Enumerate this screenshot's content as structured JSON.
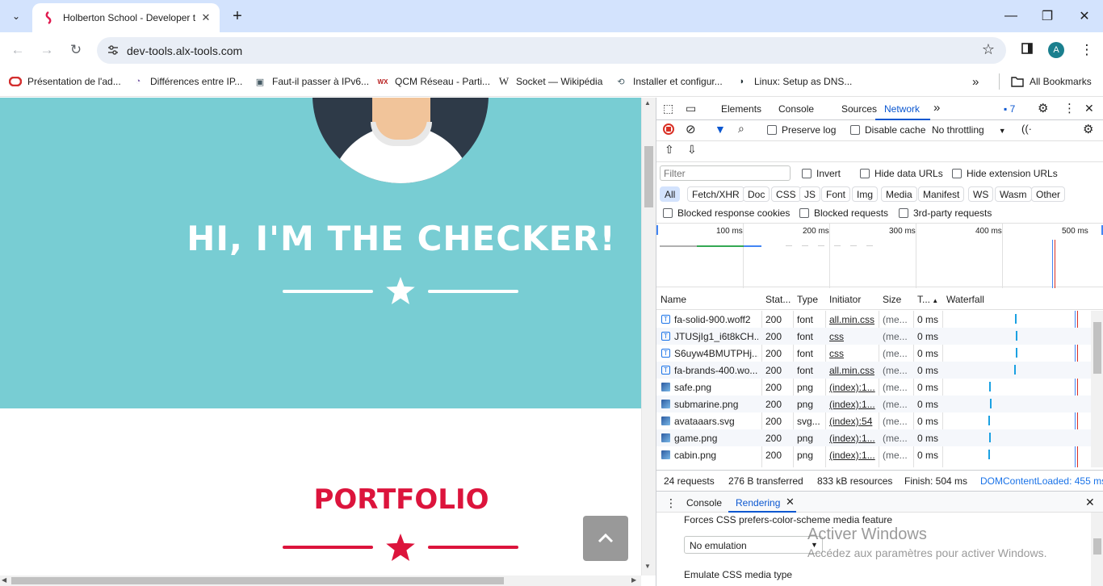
{
  "browser": {
    "tab": {
      "title": "Holberton School - Developer t",
      "close": "✕"
    },
    "new_tab": "+",
    "window_controls": {
      "minimize": "—",
      "restore": "❐",
      "close": "✕"
    },
    "address": {
      "url": "dev-tools.alx-tools.com"
    },
    "profile_initial": "A",
    "bookmarks": [
      {
        "label": "Présentation de l'ad...",
        "icon": "oracle-icon",
        "color": "#d32f2f"
      },
      {
        "label": "Différences entre IP...",
        "icon": "site-icon",
        "color": "#7a5fa8"
      },
      {
        "label": "Faut-il passer à IPv6...",
        "icon": "laptop-icon",
        "color": "#455a64"
      },
      {
        "label": "QCM Réseau - Parti...",
        "icon": "wix-icon",
        "color": "#b71c1c"
      },
      {
        "label": "Socket — Wikipédia",
        "icon": "wikipedia-icon",
        "color": "#000000"
      },
      {
        "label": "Installer et configur...",
        "icon": "site-icon",
        "color": "#455a64"
      },
      {
        "label": "Linux: Setup as DNS...",
        "icon": "site-icon",
        "color": "#263238"
      }
    ],
    "bookmarks_overflow": "»",
    "all_bookmarks": "All Bookmarks"
  },
  "page": {
    "hero_title": "HI, I'M THE CHECKER!",
    "portfolio_title": "PORTFOLIO",
    "scroll_top_icon": "chevron-up-icon",
    "colors": {
      "hero_bg": "#78cdd3",
      "accent": "#dc143c"
    }
  },
  "devtools": {
    "tabs": [
      "Elements",
      "Console",
      "Sources",
      "Network"
    ],
    "active_tab": "Network",
    "issues_count": "7",
    "network": {
      "preserve_log": "Preserve log",
      "disable_cache": "Disable cache",
      "throttling": "No throttling",
      "filter_placeholder": "Filter",
      "invert": "Invert",
      "hide_data_urls": "Hide data URLs",
      "hide_extension_urls": "Hide extension URLs",
      "type_filters": [
        "All",
        "Fetch/XHR",
        "Doc",
        "CSS",
        "JS",
        "Font",
        "Img",
        "Media",
        "Manifest",
        "WS",
        "Wasm",
        "Other"
      ],
      "blocked_response_cookies": "Blocked response cookies",
      "blocked_requests": "Blocked requests",
      "third_party_requests": "3rd-party requests",
      "timeline_ticks": [
        "100 ms",
        "200 ms",
        "300 ms",
        "400 ms",
        "500 ms"
      ],
      "columns": [
        "Name",
        "Stat...",
        "Type",
        "Initiator",
        "Size",
        "T...",
        "Waterfall"
      ],
      "rows": [
        {
          "name": "fa-solid-900.woff2",
          "status": "200",
          "type": "font",
          "initiator": "all.min.css",
          "size": "(me...",
          "time": "0 ms",
          "kind": "font"
        },
        {
          "name": "JTUSjIg1_i6t8kCH...",
          "status": "200",
          "type": "font",
          "initiator": "css",
          "size": "(me...",
          "time": "0 ms",
          "kind": "font"
        },
        {
          "name": "S6uyw4BMUTPHj...",
          "status": "200",
          "type": "font",
          "initiator": "css",
          "size": "(me...",
          "time": "0 ms",
          "kind": "font"
        },
        {
          "name": "fa-brands-400.wo...",
          "status": "200",
          "type": "font",
          "initiator": "all.min.css",
          "size": "(me...",
          "time": "0 ms",
          "kind": "font"
        },
        {
          "name": "safe.png",
          "status": "200",
          "type": "png",
          "initiator": "(index):1...",
          "size": "(me...",
          "time": "0 ms",
          "kind": "img"
        },
        {
          "name": "submarine.png",
          "status": "200",
          "type": "png",
          "initiator": "(index):1...",
          "size": "(me...",
          "time": "0 ms",
          "kind": "img"
        },
        {
          "name": "avataaars.svg",
          "status": "200",
          "type": "svg...",
          "initiator": "(index):54",
          "size": "(me...",
          "time": "0 ms",
          "kind": "img"
        },
        {
          "name": "game.png",
          "status": "200",
          "type": "png",
          "initiator": "(index):1...",
          "size": "(me...",
          "time": "0 ms",
          "kind": "img"
        },
        {
          "name": "cabin.png",
          "status": "200",
          "type": "png",
          "initiator": "(index):1...",
          "size": "(me...",
          "time": "0 ms",
          "kind": "img"
        }
      ],
      "summary": {
        "requests": "24 requests",
        "transferred": "276 B transferred",
        "resources": "833 kB resources",
        "finish": "Finish: 504 ms",
        "dom_content_loaded": "DOMContentLoaded: 455 ms"
      }
    },
    "drawer": {
      "tabs": [
        "Console",
        "Rendering"
      ],
      "active_tab": "Rendering",
      "color_scheme_label": "Forces CSS prefers-color-scheme media feature",
      "color_scheme_value": "No emulation",
      "media_type_label": "Emulate CSS media type"
    }
  },
  "os_overlay": {
    "title": "Activer Windows",
    "subtitle": "Accédez aux paramètres pour activer Windows."
  }
}
